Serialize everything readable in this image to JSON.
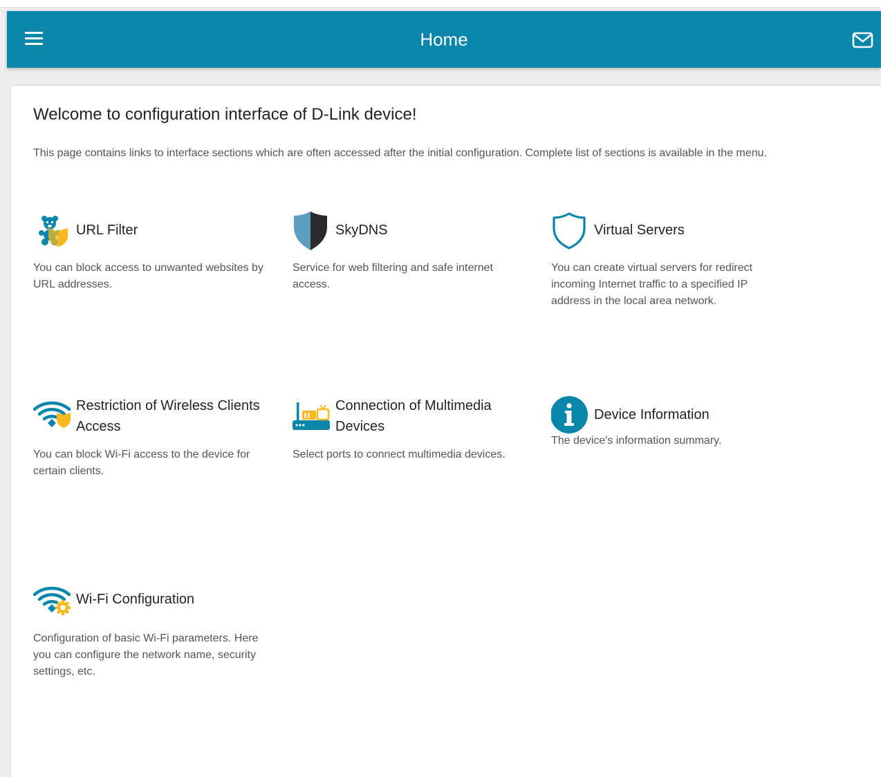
{
  "header": {
    "title": "Home"
  },
  "content": {
    "welcome": "Welcome to configuration interface of D-Link device!",
    "intro": "This page contains links to interface sections which are often accessed after the initial configuration. Complete list of sections is available in the menu.",
    "tiles": [
      {
        "title": "URL Filter",
        "description": "You can block access to unwanted websites by URL addresses.",
        "icon": "teddy-bear-shield-icon"
      },
      {
        "title": "SkyDNS",
        "description": "Service for web filtering and safe internet access.",
        "icon": "skydns-shield-icon"
      },
      {
        "title": "Virtual Servers",
        "description": "You can create virtual servers for redirect incoming Internet traffic to a specified IP address in the local area network.",
        "icon": "shield-outline-icon"
      },
      {
        "title": "Restriction of Wireless Clients Access",
        "description": "You can block Wi-Fi access to the device for certain clients.",
        "icon": "wifi-shield-icon"
      },
      {
        "title": "Connection of Multimedia Devices",
        "description": "Select ports to connect multimedia devices.",
        "icon": "router-tv-icon"
      },
      {
        "title": "Device Information",
        "description": "The device's information summary.",
        "icon": "info-circle-icon"
      },
      {
        "title": "Wi-Fi Configuration",
        "description": "Configuration of basic Wi-Fi parameters. Here you can configure the network name, security settings, etc.",
        "icon": "wifi-gear-icon"
      }
    ]
  },
  "colors": {
    "header_bg": "#0a86ab",
    "icon_blue": "#0a86ab",
    "icon_yellow": "#f5b91e"
  }
}
